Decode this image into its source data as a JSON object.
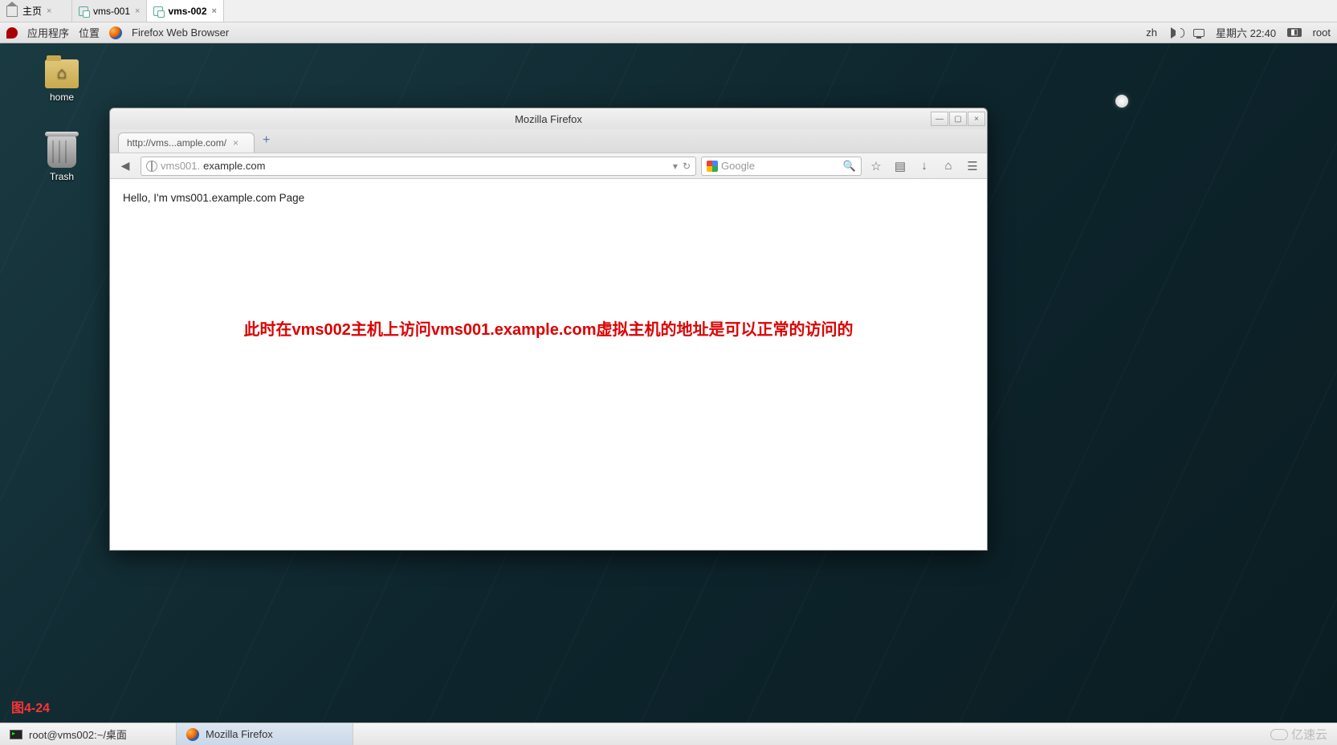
{
  "doc_tabs": [
    {
      "label": "主页",
      "active": false,
      "icon": "home"
    },
    {
      "label": "vms-001",
      "active": false,
      "icon": "vm"
    },
    {
      "label": "vms-002",
      "active": true,
      "icon": "vm"
    }
  ],
  "gnome": {
    "applications": "应用程序",
    "places": "位置",
    "app_title": "Firefox Web Browser",
    "lang": "zh",
    "day_time": "星期六  22:40",
    "user": "root"
  },
  "desktop_icons": {
    "home": "home",
    "trash": "Trash"
  },
  "firefox": {
    "title": "Mozilla Firefox",
    "tab_label": "http://vms...ample.com/",
    "url_light_prefix": "vms001.",
    "url_dark": "example.com",
    "dropdown": "▾",
    "reload": "↻",
    "search_placeholder": "Google",
    "page_text": "Hello, I'm vms001.example.com Page",
    "annotation": "此时在vms002主机上访问vms001.example.com虚拟主机的地址是可以正常的访问的"
  },
  "figure_label": "图4-24",
  "taskbar": {
    "terminal": "root@vms002:~/桌面",
    "firefox": "Mozilla Firefox",
    "logo": "亿速云"
  }
}
